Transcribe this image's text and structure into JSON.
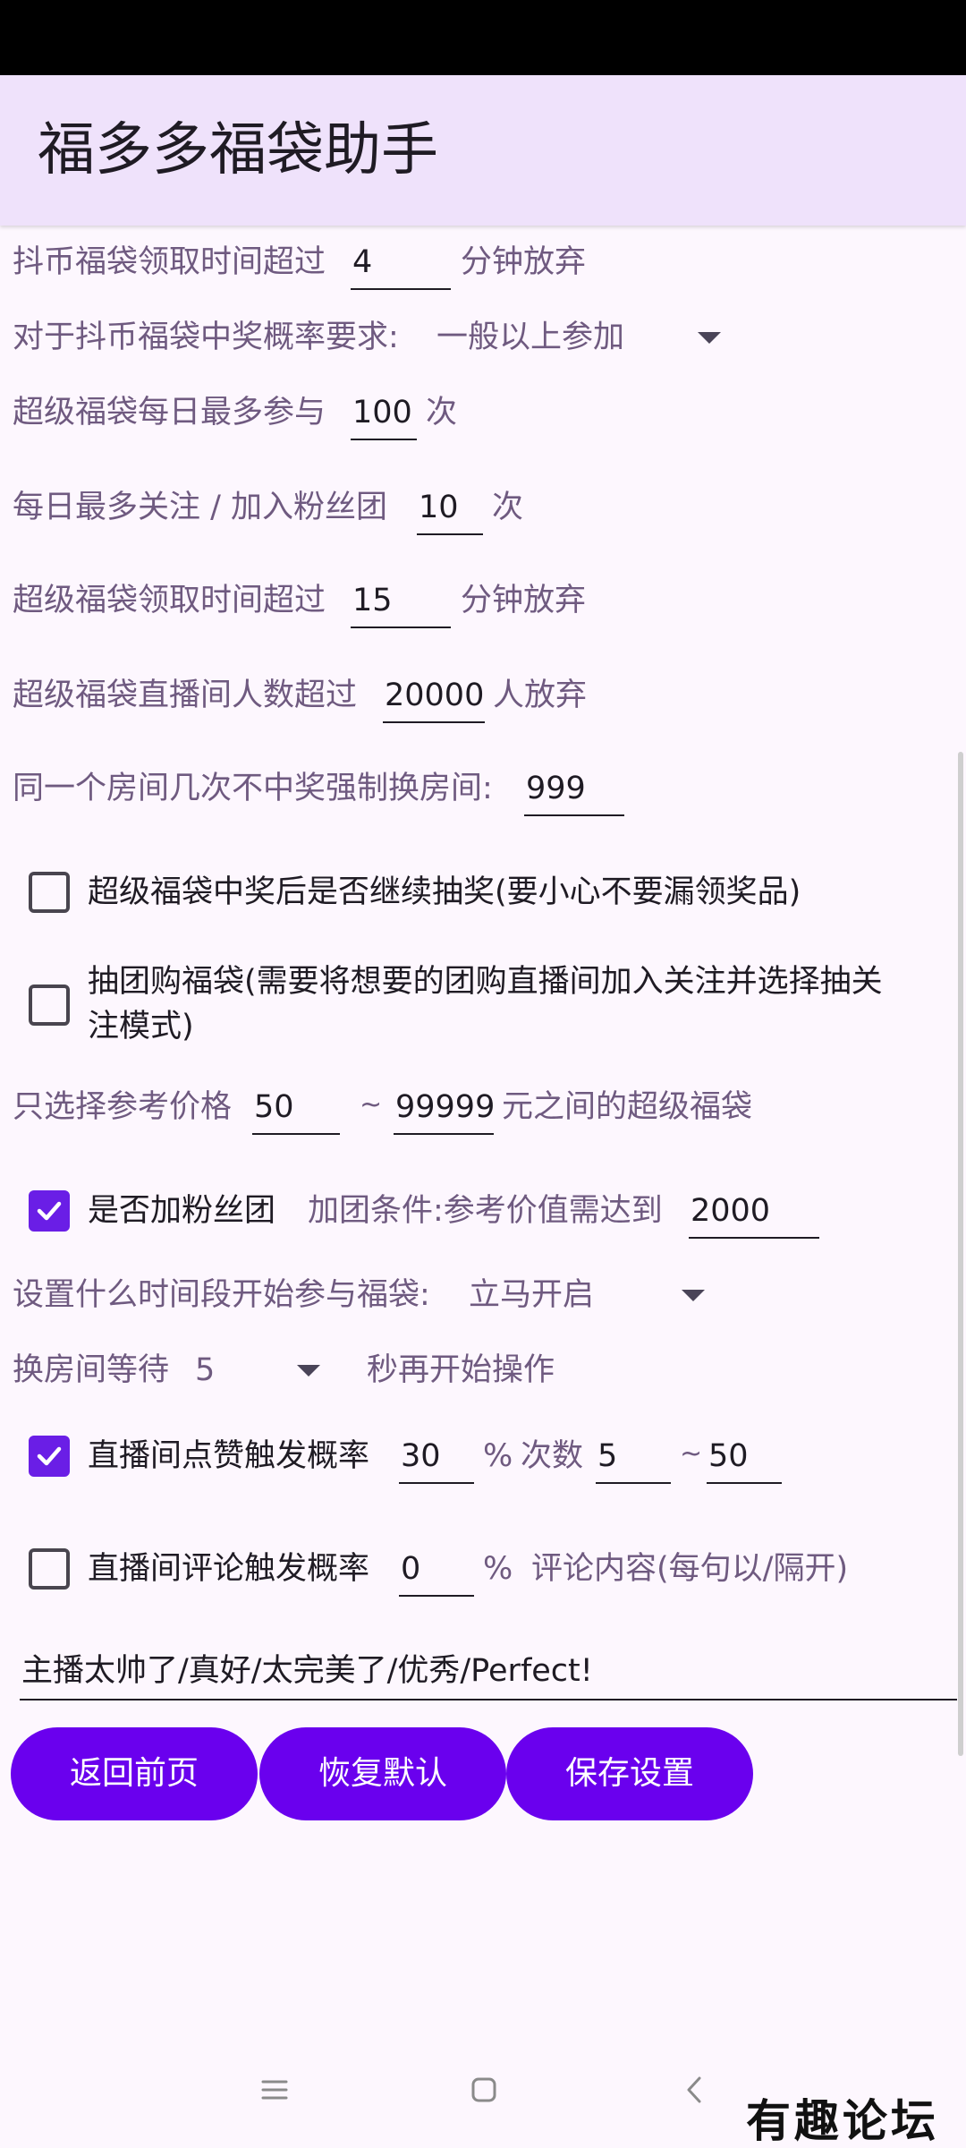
{
  "app": {
    "title": "福多多福袋助手"
  },
  "settings": {
    "coin_timeout": {
      "label": "抖币福袋领取时间超过",
      "value": "4",
      "suffix": "分钟放弃"
    },
    "coin_probability": {
      "label": "对于抖币福袋中奖概率要求:",
      "selected": "一般以上参加"
    },
    "super_daily_max": {
      "label": "超级福袋每日最多参与",
      "value": "100",
      "suffix": "次"
    },
    "daily_follow_max": {
      "label": "每日最多关注 / 加入粉丝团",
      "value": "10",
      "suffix": "次"
    },
    "super_timeout": {
      "label": "超级福袋领取时间超过",
      "value": "15",
      "suffix": "分钟放弃"
    },
    "super_room_people": {
      "label": "超级福袋直播间人数超过",
      "value": "20000",
      "suffix": "人放弃"
    },
    "room_switch": {
      "label": "同一个房间几次不中奖强制换房间:",
      "value": "999"
    },
    "continue_after_win": {
      "label": "超级福袋中奖后是否继续抽奖(要小心不要漏领奖品)",
      "checked": false
    },
    "group_buy": {
      "label_line1": "抽团购福袋(需要将想要的团购直播间加入关注并选择抽关",
      "label_line2": "注模式)",
      "checked": false
    },
    "price_range": {
      "label": "只选择参考价格",
      "min": "50",
      "separator": "~",
      "max": "99999",
      "suffix": "元之间的超级福袋"
    },
    "join_fan_club": {
      "label": "是否加粉丝团",
      "checked": true,
      "condition_label": "加团条件:参考价值需达到",
      "condition_value": "2000"
    },
    "start_time": {
      "label": "设置什么时间段开始参与福袋:",
      "selected": "立马开启"
    },
    "room_wait": {
      "label": "换房间等待",
      "selected": "5",
      "suffix": "秒再开始操作"
    },
    "like": {
      "label": "直播间点赞触发概率",
      "checked": true,
      "value": "30",
      "percent": "%",
      "count_label": "次数",
      "count_min": "5",
      "tilde": "~",
      "count_max": "50"
    },
    "comment": {
      "label": "直播间评论触发概率",
      "checked": false,
      "value": "0",
      "percent": "%",
      "content_label": "评论内容(每句以/隔开)",
      "content": "主播太帅了/真好/太完美了/优秀/Perfect!"
    }
  },
  "buttons": {
    "back": "返回前页",
    "reset": "恢复默认",
    "save": "保存设置"
  },
  "watermark": "有趣论坛",
  "colors": {
    "accent": "#6a00ee",
    "appbar": "#efe2fb",
    "background": "#fdf7fe",
    "label": "#6f5a80"
  },
  "icons": {
    "dropdown": "triangle-down",
    "check": "check-mark",
    "nav_menu": "three-lines",
    "nav_home": "rounded-square",
    "nav_back": "chevron-left"
  }
}
